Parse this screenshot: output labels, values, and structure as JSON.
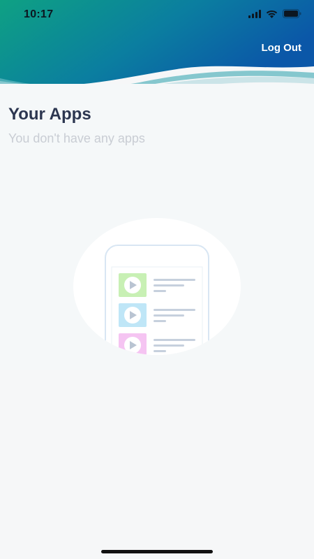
{
  "status_bar": {
    "time": "10:17",
    "icons": [
      "signal-icon",
      "wifi-icon",
      "battery-icon"
    ]
  },
  "header": {
    "logout_label": "Log Out",
    "gradient_start": "#0e9a82",
    "gradient_end": "#0b5aa6"
  },
  "main": {
    "title": "Your Apps",
    "empty_message": "You don't have any apps",
    "illustration": "empty-apps-phone-illustration"
  },
  "colors": {
    "title": "#2c3650",
    "subtitle": "#c9cdd4",
    "background": "#f6f7f8"
  }
}
